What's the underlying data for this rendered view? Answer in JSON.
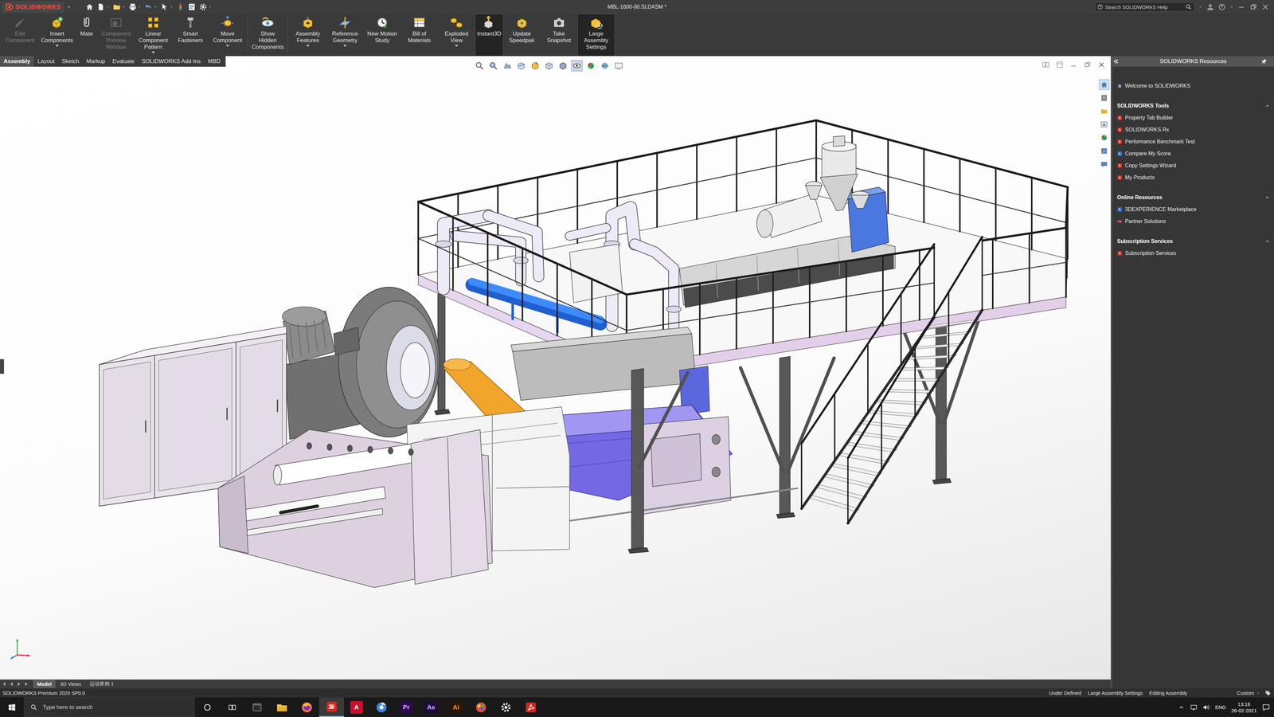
{
  "window": {
    "title": "MBL-1600-00.SLDASM *"
  },
  "logo": {
    "text": "SOLIDWORKS"
  },
  "search": {
    "placeholder": "Search SOLIDWORKS Help"
  },
  "command_manager": {
    "groups": [
      [
        {
          "label": "Edit Component",
          "disabled": true,
          "selected": false,
          "dropdown": false
        },
        {
          "label": "Insert Components",
          "disabled": false,
          "selected": false,
          "dropdown": true
        },
        {
          "label": "Mate",
          "disabled": false,
          "selected": false,
          "dropdown": false
        },
        {
          "label": "Component Preview Window",
          "disabled": true,
          "selected": false,
          "dropdown": false
        },
        {
          "label": "Linear Component Pattern",
          "disabled": false,
          "selected": false,
          "dropdown": true
        },
        {
          "label": "Smart Fasteners",
          "disabled": false,
          "selected": false,
          "dropdown": false
        },
        {
          "label": "Move Component",
          "disabled": false,
          "selected": false,
          "dropdown": true
        }
      ],
      [
        {
          "label": "Show Hidden Components",
          "disabled": false,
          "selected": false,
          "dropdown": false
        }
      ],
      [
        {
          "label": "Assembly Features",
          "disabled": false,
          "selected": false,
          "dropdown": true
        },
        {
          "label": "Reference Geometry",
          "disabled": false,
          "selected": false,
          "dropdown": true
        },
        {
          "label": "New Motion Study",
          "disabled": false,
          "selected": false,
          "dropdown": false
        },
        {
          "label": "Bill of Materials",
          "disabled": false,
          "selected": false,
          "dropdown": false
        },
        {
          "label": "Exploded View",
          "disabled": false,
          "selected": false,
          "dropdown": true
        },
        {
          "label": "Instant3D",
          "disabled": false,
          "selected": true,
          "dropdown": false
        },
        {
          "label": "Update Speedpak",
          "disabled": false,
          "selected": false,
          "dropdown": false
        },
        {
          "label": "Take Snapshot",
          "disabled": false,
          "selected": false,
          "dropdown": false
        },
        {
          "label": "Large Assembly Settings",
          "disabled": false,
          "selected": true,
          "dropdown": false
        }
      ]
    ]
  },
  "tabs": [
    {
      "label": "Assembly",
      "selected": true
    },
    {
      "label": "Layout",
      "selected": false
    },
    {
      "label": "Sketch",
      "selected": false
    },
    {
      "label": "Markup",
      "selected": false
    },
    {
      "label": "Evaluate",
      "selected": false
    },
    {
      "label": "SOLIDWORKS Add-Ins",
      "selected": false
    },
    {
      "label": "MBD",
      "selected": false
    }
  ],
  "view_toolbar": {
    "buttons": [
      {
        "selected": false
      },
      {
        "selected": false
      },
      {
        "selected": false
      },
      {
        "selected": false
      },
      {
        "selected": false
      },
      {
        "selected": false
      },
      {
        "selected": false
      },
      {
        "selected": true
      },
      {
        "selected": false
      },
      {
        "selected": false
      },
      {
        "selected": false
      }
    ]
  },
  "task_pane": {
    "title": "SOLIDWORKS Resources",
    "welcome": "Welcome to SOLIDWORKS",
    "tabs": [
      {
        "selected": true
      },
      {
        "selected": false
      },
      {
        "selected": false
      },
      {
        "selected": false
      },
      {
        "selected": false
      },
      {
        "selected": false
      },
      {
        "selected": false
      }
    ],
    "sections": [
      {
        "title": "SOLIDWORKS Tools",
        "expanded": true,
        "items": [
          "Property Tab Builder",
          "SOLIDWORKS Rx",
          "Performance Benchmark Test",
          "Compare My Score",
          "Copy Settings Wizard",
          "My Products"
        ]
      },
      {
        "title": "Online Resources",
        "expanded": true,
        "items": [
          "3DEXPERIENCE Marketplace",
          "Partner Solutions"
        ]
      },
      {
        "title": "Subscription Services",
        "expanded": true,
        "items": [
          "Subscription Services"
        ]
      }
    ]
  },
  "model_tabs": [
    {
      "label": "Model",
      "selected": true
    },
    {
      "label": "3D Views",
      "selected": false
    },
    {
      "label": "运动算例 1",
      "selected": false
    }
  ],
  "status_bar": {
    "product": "SOLIDWORKS Premium 2020 SP0.0",
    "fields": [
      "Under Defined",
      "Large Assembly Settings",
      "Editing Assembly"
    ],
    "units": "Custom"
  },
  "taskbar": {
    "search_placeholder": "Type here to search",
    "apps": [
      {
        "kind": "window",
        "color": "#6a6a6a",
        "active": false
      },
      {
        "kind": "explorer",
        "color": "#f2c94c",
        "active": false
      },
      {
        "kind": "firefox",
        "color": "#ff7139",
        "active": false
      },
      {
        "kind": "solidworks",
        "color": "#d52b1e",
        "active": true
      },
      {
        "kind": "glyph",
        "glyph": "A",
        "color": "#c8102e",
        "active": false
      },
      {
        "kind": "browser",
        "color": "#3b8ad9",
        "active": false
      },
      {
        "kind": "glyph",
        "glyph": "Pr",
        "color": "#2a0a4a",
        "active": false
      },
      {
        "kind": "glyph",
        "glyph": "Ae",
        "color": "#1f0a3a",
        "active": false
      },
      {
        "kind": "glyph",
        "glyph": "Ai",
        "color": "#2b1500",
        "active": false
      },
      {
        "kind": "paint",
        "color": "#e74c3c",
        "active": false
      },
      {
        "kind": "settings",
        "color": "#ffffff",
        "active": false
      },
      {
        "kind": "acrobat",
        "color": "#d4261c",
        "active": false
      }
    ],
    "language": "ENG",
    "time": "13:18",
    "date": "26-02-2021"
  }
}
